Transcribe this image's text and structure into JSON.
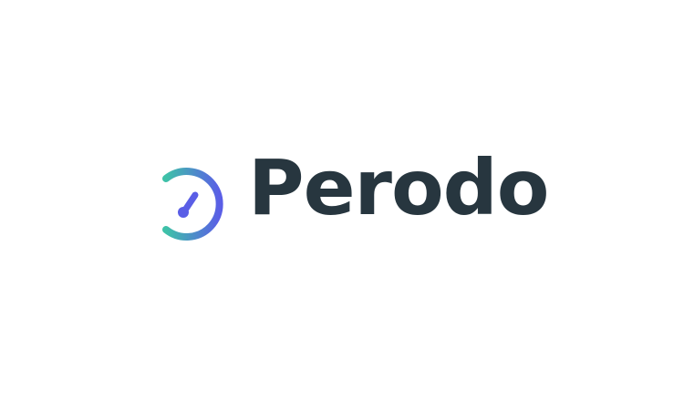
{
  "brand": {
    "name": "Perodo",
    "wordmark_color": "#27363f",
    "gradient_start": "#3ec1a8",
    "gradient_end": "#5a5ee6",
    "icon": "stopwatch-speed-icon"
  }
}
